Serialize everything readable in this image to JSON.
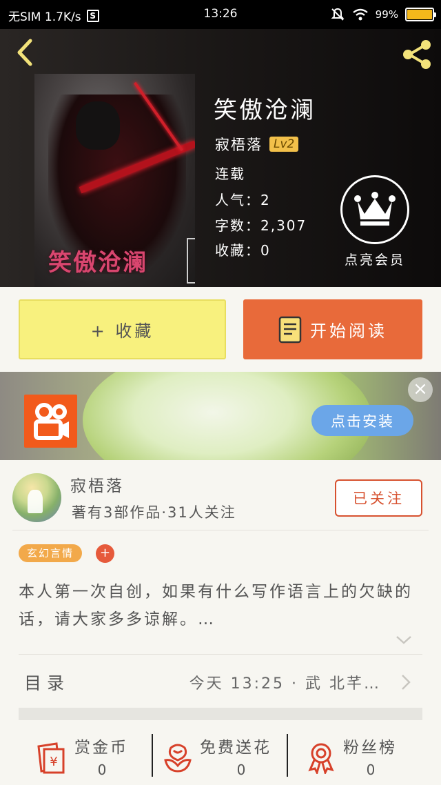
{
  "status_bar": {
    "carrier": "无SIM 1.7K/s",
    "s_badge": "S",
    "time": "13:26",
    "battery_percent": "99%",
    "battery_level": 0.99
  },
  "book": {
    "title": "笑傲沧澜",
    "cover_title": "笑傲沧澜",
    "author": "寂梧落",
    "level": "Lv2",
    "status": "连载",
    "popularity": "人气：2",
    "word_count": "字数：2,307",
    "favorites": "收藏：0"
  },
  "vip": {
    "label": "点亮会员"
  },
  "actions": {
    "favorite_label": "+ 收藏",
    "read_label": "开始阅读"
  },
  "ad": {
    "install_label": "点击安装",
    "close_glyph": "×"
  },
  "author_section": {
    "name": "寂梧落",
    "stats": "著有3部作品·31人关注",
    "follow_label": "已关注"
  },
  "tags": [
    "玄幻言情"
  ],
  "tag_add": "+",
  "description": "本人第一次自创，如果有什么写作语言上的欠缺的话，请大家多多谅解。…",
  "toc": {
    "label": "目录",
    "latest": "今天 13:25 · 武 北芊…"
  },
  "bottom": [
    {
      "title": "赏金币",
      "count": "0",
      "icon": "coin-envelope-icon"
    },
    {
      "title": "免费送花",
      "count": "0",
      "icon": "flower-icon"
    },
    {
      "title": "粉丝榜",
      "count": "0",
      "icon": "medal-icon"
    }
  ],
  "colors": {
    "accent_orange": "#e86a3a",
    "fav_yellow": "#f8f17e",
    "header_bg": "#1a1716",
    "link_blue": "#6ba6e8",
    "icon_red": "#d7412a"
  }
}
